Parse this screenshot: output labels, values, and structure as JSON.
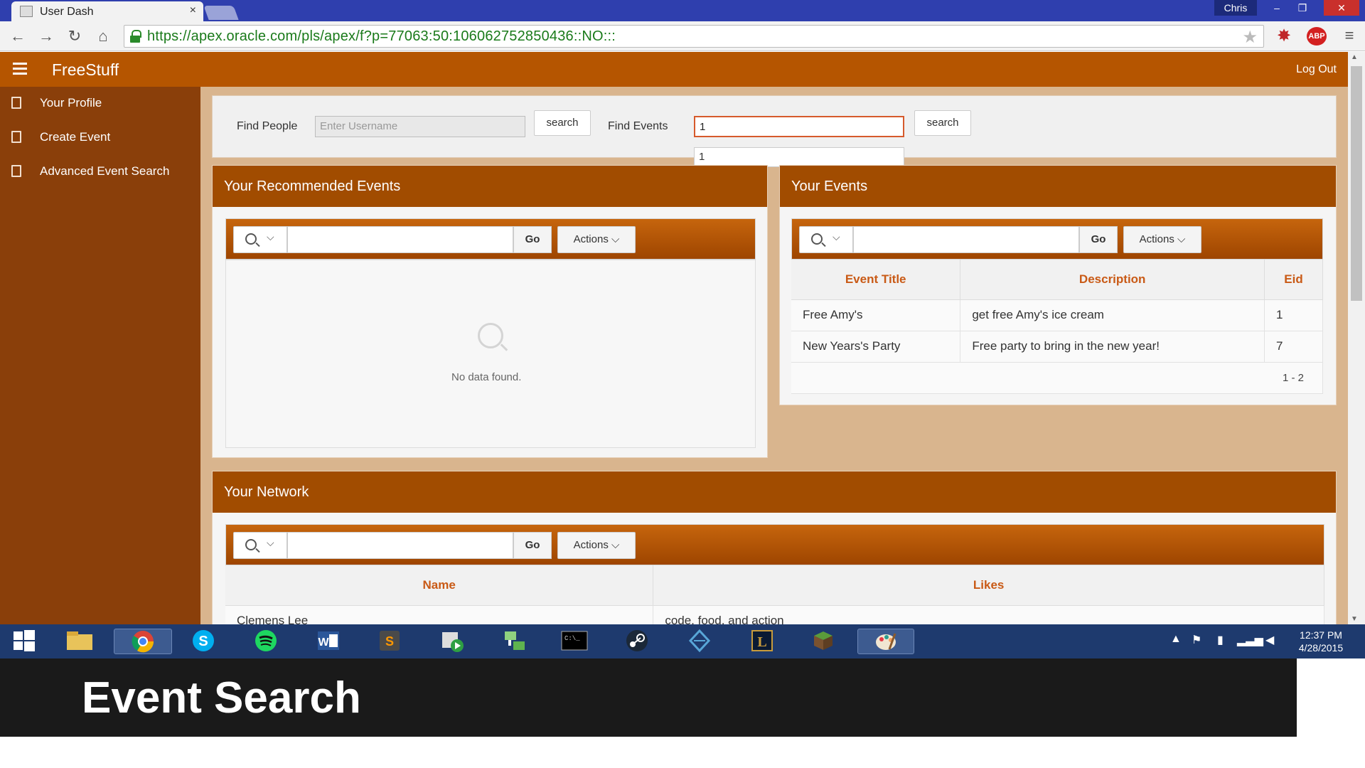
{
  "browser": {
    "tab_title": "User Dash",
    "tab_close": "×",
    "user_badge": "Chris",
    "url": "https://apex.oracle.com/pls/apex/f?p=77063:50:106062752850436::NO:::",
    "controls": {
      "minimize": "–",
      "restore": "❐",
      "close": "✕"
    },
    "nav": {
      "back": "←",
      "forward": "→",
      "reload": "↻",
      "home": "⌂",
      "star": "★",
      "menu": "≡"
    },
    "extensions": {
      "ext1_icon": "✸",
      "adblock_label": "ABP"
    }
  },
  "app": {
    "title": "FreeStuff",
    "logout": "Log Out"
  },
  "sidebar": {
    "items": [
      {
        "label": "Your Profile"
      },
      {
        "label": "Create Event"
      },
      {
        "label": "Advanced Event Search"
      }
    ]
  },
  "search": {
    "people_label": "Find People",
    "people_placeholder": "Enter Username",
    "people_button": "search",
    "events_label": "Find Events",
    "events_value": "1",
    "events_button": "search",
    "autocomplete_option": "1"
  },
  "recommended": {
    "title": "Your Recommended Events",
    "go": "Go",
    "actions": "Actions ⌵",
    "empty": "No data found."
  },
  "your_events": {
    "title": "Your Events",
    "go": "Go",
    "actions": "Actions ⌵",
    "columns": [
      "Event Title",
      "Description",
      "Eid"
    ],
    "rows": [
      [
        "Free Amy's",
        "get free Amy's ice cream",
        "1"
      ],
      [
        "New Years's Party",
        "Free party to bring in the new year!",
        "7"
      ]
    ],
    "pagination": "1 - 2"
  },
  "network": {
    "title": "Your Network",
    "go": "Go",
    "actions": "Actions ⌵",
    "columns": [
      "Name",
      "Likes"
    ],
    "rows": [
      [
        "Clemens Lee",
        "code, food, and action"
      ]
    ]
  },
  "taskbar": {
    "clock_time": "12:37 PM",
    "clock_date": "4/28/2015",
    "icons": [
      "windows-start",
      "file-explorer",
      "chrome",
      "skype",
      "spotify",
      "word",
      "sublime-text",
      "media-player",
      "network-manager",
      "command-prompt",
      "steam",
      "dota",
      "league-of-legends",
      "minecraft",
      "paint"
    ]
  },
  "caption": {
    "text": "Event Search"
  }
}
